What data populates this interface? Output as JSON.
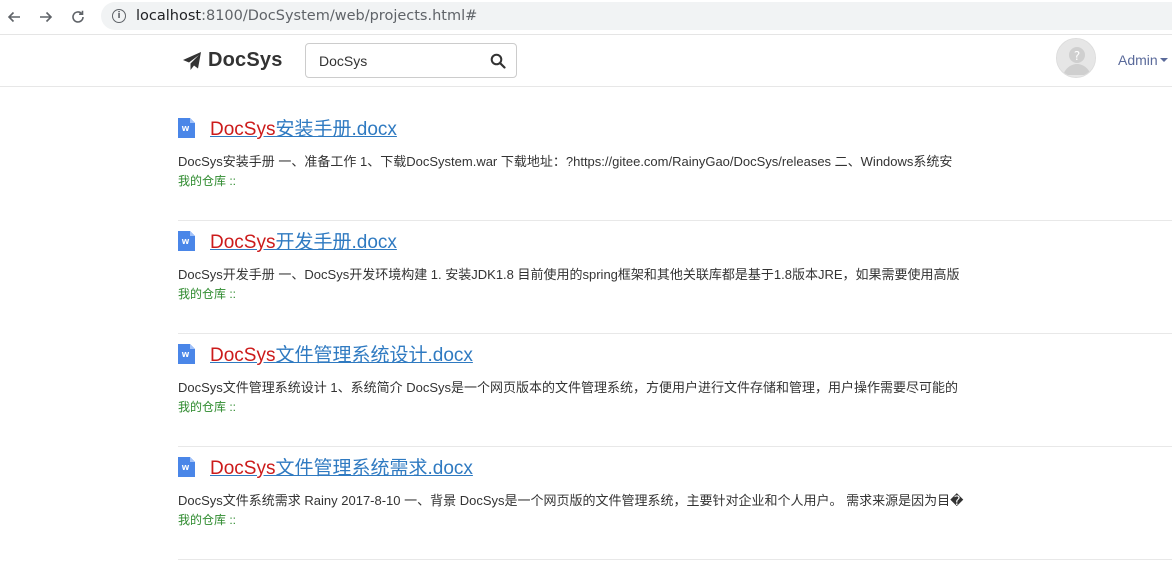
{
  "browser": {
    "url_host": "localhost",
    "url_rest": ":8100/DocSystem/web/projects.html#"
  },
  "header": {
    "brand": "DocSys",
    "search_value": "DocSys",
    "user": "Admin"
  },
  "results": [
    {
      "title_highlight": "DocSys",
      "title_rest": "安装手册.docx",
      "snippet": "DocSys安装手册 一、准备工作 1、下载DocSystem.war 下载地址：?https://gitee.com/RainyGao/DocSys/releases 二、Windows系统安",
      "repo": "我的仓库 ::"
    },
    {
      "title_highlight": "DocSys",
      "title_rest": "开发手册.docx",
      "snippet": "DocSys开发手册 一、DocSys开发环境构建 1. 安装JDK1.8 目前使用的spring框架和其他关联库都是基于1.8版本JRE，如果需要使用高版",
      "repo": "我的仓库 ::"
    },
    {
      "title_highlight": "DocSys",
      "title_rest": "文件管理系统设计.docx",
      "snippet": "DocSys文件管理系统设计 1、系统简介 DocSys是一个网页版本的文件管理系统，方便用户进行文件存储和管理，用户操作需要尽可能的",
      "repo": "我的仓库 ::"
    },
    {
      "title_highlight": "DocSys",
      "title_rest": "文件管理系统需求.docx",
      "snippet": "DocSys文件系统需求 Rainy 2017-8-10 一、背景 DocSys是一个网页版的文件管理系统，主要针对企业和个人用户。 需求来源是因为目�",
      "repo": "我的仓库 ::"
    }
  ],
  "colors": {
    "highlight": "#cc1b1b",
    "link": "#2f7ac1",
    "repo": "#2d8a2d",
    "doc_icon": "#4a86e8"
  }
}
